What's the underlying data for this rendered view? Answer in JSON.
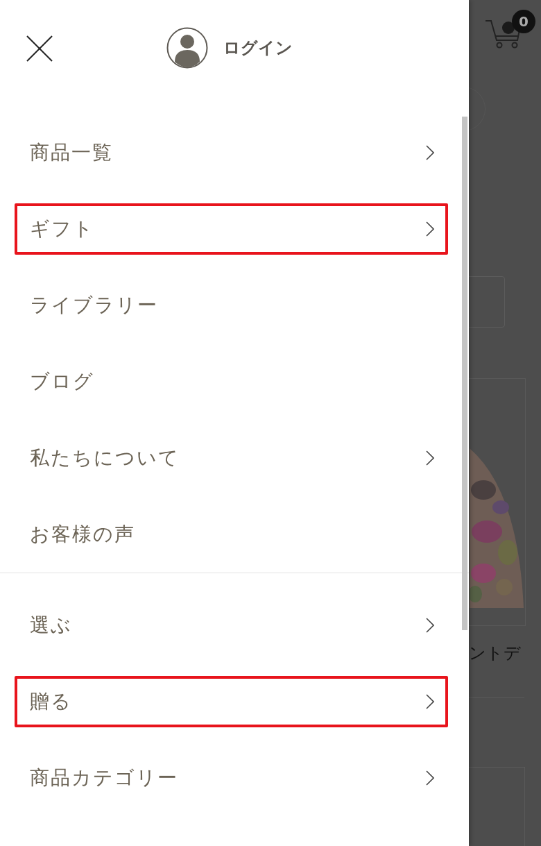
{
  "header": {
    "login_label": "ログイン"
  },
  "menu_groups": [
    {
      "items": [
        {
          "label": "商品一覧",
          "has_submenu": true,
          "highlighted": false
        },
        {
          "label": "ギフト",
          "has_submenu": true,
          "highlighted": true
        },
        {
          "label": "ライブラリー",
          "has_submenu": false,
          "highlighted": false
        },
        {
          "label": "ブログ",
          "has_submenu": false,
          "highlighted": false
        },
        {
          "label": "私たちについて",
          "has_submenu": true,
          "highlighted": false
        },
        {
          "label": "お客様の声",
          "has_submenu": false,
          "highlighted": false
        }
      ]
    },
    {
      "items": [
        {
          "label": "選ぶ",
          "has_submenu": true,
          "highlighted": false
        },
        {
          "label": "贈る",
          "has_submenu": true,
          "highlighted": true
        },
        {
          "label": "商品カテゴリー",
          "has_submenu": true,
          "highlighted": false
        }
      ]
    }
  ],
  "background_page": {
    "cart_count": "0",
    "product_caption": "ントデ"
  }
}
